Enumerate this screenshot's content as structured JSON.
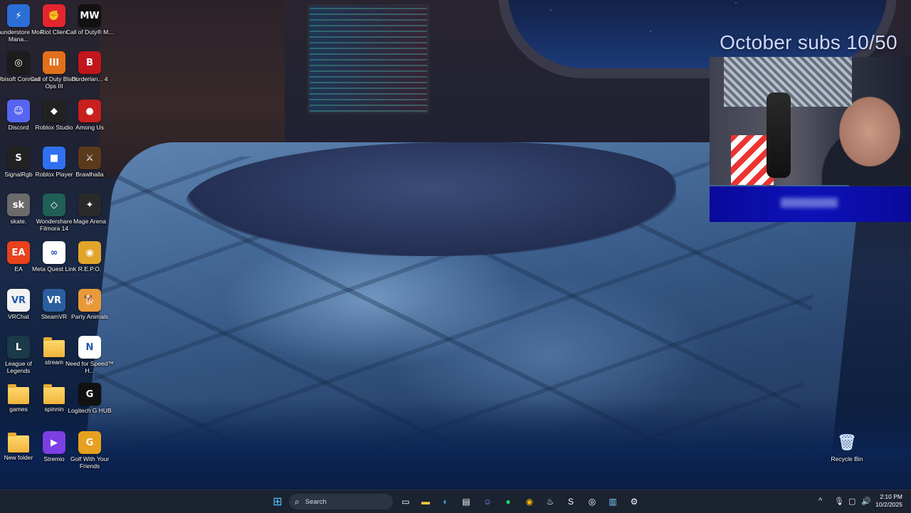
{
  "overlay": {
    "subs_text": "October subs 10/50"
  },
  "desktop_icons": [
    {
      "label": "Thunderstore Mod Mana...",
      "glyph": "⚡",
      "color": "#2a6fd6",
      "icon": "thunderstore-icon"
    },
    {
      "label": "Riot Client",
      "glyph": "✊",
      "color": "#e3262e",
      "icon": "riot-icon"
    },
    {
      "label": "Call of Duty® M...",
      "glyph": "MW",
      "color": "#111111",
      "icon": "cod-mw-icon"
    },
    {
      "label": "Ubisoft Connect",
      "glyph": "◎",
      "color": "#1c1c1c",
      "icon": "ubisoft-icon"
    },
    {
      "label": "Call of Duty Black Ops III",
      "glyph": "III",
      "color": "#e0701c",
      "icon": "cod-bo3-icon"
    },
    {
      "label": "Borderlan... 4",
      "glyph": "B",
      "color": "#c2161d",
      "icon": "borderlands-icon"
    },
    {
      "label": "Discord",
      "glyph": "☺",
      "color": "#5865f2",
      "icon": "discord-icon"
    },
    {
      "label": "Roblox Studio",
      "glyph": "◆",
      "color": "#222222",
      "icon": "roblox-studio-icon"
    },
    {
      "label": "Among Us",
      "glyph": "●",
      "color": "#c8201f",
      "icon": "among-us-icon"
    },
    {
      "label": "SignalRgb",
      "glyph": "S",
      "color": "#222222",
      "icon": "signalrgb-icon"
    },
    {
      "label": "Roblox Player",
      "glyph": "■",
      "color": "#2f6ff0",
      "icon": "roblox-icon"
    },
    {
      "label": "Brawlhalla",
      "glyph": "⚔",
      "color": "#5b3a1c",
      "icon": "brawlhalla-icon"
    },
    {
      "label": "skate.",
      "glyph": "sk",
      "color": "#6b6b6b",
      "icon": "skate-icon"
    },
    {
      "label": "Wondershare Filmora 14",
      "glyph": "◇",
      "color": "#1f5f55",
      "icon": "filmora-icon"
    },
    {
      "label": "Mage Arena",
      "glyph": "✦",
      "color": "#2a2a2a",
      "icon": "mage-arena-icon"
    },
    {
      "label": "EA",
      "glyph": "EA",
      "color": "#e8421c",
      "icon": "ea-icon"
    },
    {
      "label": "Meta Quest Link",
      "glyph": "∞",
      "color": "#ffffff",
      "icon": "meta-icon"
    },
    {
      "label": "R.E.P.O.",
      "glyph": "◉",
      "color": "#e0a52a",
      "icon": "repo-icon"
    },
    {
      "label": "VRChat",
      "glyph": "VR",
      "color": "#f2f2f2",
      "icon": "vrchat-icon"
    },
    {
      "label": "SteamVR",
      "glyph": "VR",
      "color": "#2b5e9e",
      "icon": "steamvr-icon"
    },
    {
      "label": "Party Animals",
      "glyph": "🐕",
      "color": "#e89a3a",
      "icon": "party-animals-icon"
    },
    {
      "label": "League of Legends",
      "glyph": "L",
      "color": "#1a3a4a",
      "icon": "league-icon"
    },
    {
      "label": "stream",
      "glyph": "",
      "color": "folder",
      "icon": "folder-icon"
    },
    {
      "label": "Need for Speed™ H...",
      "glyph": "N",
      "color": "#ffffff",
      "icon": "nfs-icon"
    },
    {
      "label": "games",
      "glyph": "",
      "color": "folder",
      "icon": "folder-icon"
    },
    {
      "label": "spinnin",
      "glyph": "",
      "color": "folder",
      "icon": "folder-icon"
    },
    {
      "label": "Logitech G HUB",
      "glyph": "G",
      "color": "#111111",
      "icon": "logitech-icon"
    },
    {
      "label": "New folder",
      "glyph": "",
      "color": "folder",
      "icon": "folder-icon"
    },
    {
      "label": "Stremio",
      "glyph": "▶",
      "color": "#7b3fe4",
      "icon": "stremio-icon"
    },
    {
      "label": "Golf With Your Friends",
      "glyph": "G",
      "color": "#e8a020",
      "icon": "golf-icon"
    }
  ],
  "recycle_bin": {
    "label": "Recycle Bin"
  },
  "taskbar": {
    "search_placeholder": "Search",
    "apps": [
      "start-icon",
      "task-view-icon",
      "file-explorer-icon",
      "edge-icon",
      "store-icon",
      "discord-icon",
      "spotify-icon",
      "chrome-icon",
      "steam-icon",
      "signalrgb-icon",
      "obs-icon",
      "notepad-icon",
      "settings-icon"
    ],
    "time": "2:10 PM",
    "date": "10/2/2025"
  }
}
